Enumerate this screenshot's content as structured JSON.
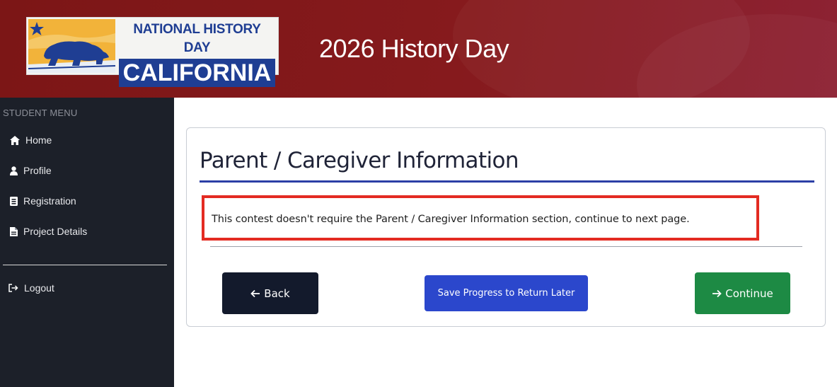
{
  "header": {
    "logo": {
      "line1": "NATIONAL HISTORY DAY",
      "line2": "CALIFORNIA"
    },
    "title": "2026 History Day"
  },
  "sidebar": {
    "heading": "STUDENT MENU",
    "items": [
      {
        "label": "Home",
        "icon": "home-icon"
      },
      {
        "label": "Profile",
        "icon": "user-icon"
      },
      {
        "label": "Registration",
        "icon": "id-card-icon"
      },
      {
        "label": "Project Details",
        "icon": "document-icon"
      }
    ],
    "logout": {
      "label": "Logout",
      "icon": "logout-icon"
    }
  },
  "main": {
    "title": "Parent / Caregiver Information",
    "notice": "This contest doesn't require the Parent / Caregiver Information section, continue to next page.",
    "buttons": {
      "back": {
        "label": "Back",
        "icon": "arrow-left-icon"
      },
      "save": {
        "label": "Save Progress to Return Later"
      },
      "continue": {
        "label": "Continue",
        "icon": "arrow-right-icon"
      }
    }
  },
  "colors": {
    "header": "#861a1d",
    "sidebar": "#1c2029",
    "title_rule": "#2c3fa6",
    "notice_border": "#e32b22",
    "back_button": "#131a2c",
    "save_button": "#2b47cc",
    "continue_button": "#1d8a44"
  }
}
